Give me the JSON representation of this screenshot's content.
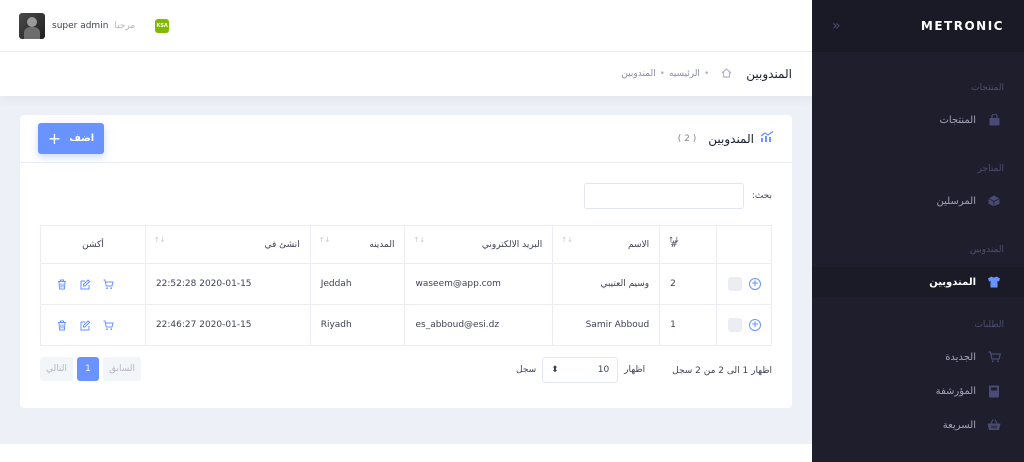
{
  "sidebar": {
    "brand": "METRONIC",
    "sections": [
      {
        "title": "المنتجات",
        "items": [
          {
            "label": "المنتجات"
          }
        ]
      },
      {
        "title": "المتاجر",
        "items": [
          {
            "label": "المرسلين"
          }
        ]
      },
      {
        "title": "المندوبين",
        "items": [
          {
            "label": "المندوبين"
          }
        ]
      },
      {
        "title": "الطلبات",
        "items": [
          {
            "label": "الجديدة"
          },
          {
            "label": "المؤرشفة"
          },
          {
            "label": "السريعة"
          }
        ]
      }
    ]
  },
  "header": {
    "greeting": "مرحبا",
    "username": "super admin",
    "flag_text": "KSA"
  },
  "subheader": {
    "title": "المندوبين",
    "crumbs": [
      "الرئيسيه",
      "المندوبين"
    ]
  },
  "card": {
    "title": "المندوبين",
    "count": "( 2 )",
    "add_label": "اضف",
    "search_label": "بحث:",
    "columns": [
      "#",
      "الاسم",
      "البريد الالكتروني",
      "المدينه",
      "انشئ في",
      "أكشن"
    ],
    "rows": [
      {
        "id": "2",
        "name": "وسيم العتيبي",
        "email": "waseem@app.com",
        "city": "Jeddah",
        "created": "2020-01-15 22:52:28"
      },
      {
        "id": "1",
        "name": "Samir Abboud",
        "email": "es_abboud@esi.dz",
        "city": "Riyadh",
        "created": "2020-01-15 22:46:27"
      }
    ],
    "info": "اظهار 1 الى 2 من 2 سجل",
    "length_show": "اظهار",
    "length_value": "10",
    "length_unit": "سجل",
    "pager": {
      "prev": "السابق",
      "current": "1",
      "next": "التالي"
    }
  },
  "colors": {
    "accent": "#6993ff",
    "sidebar_bg": "#1e1e2d"
  }
}
